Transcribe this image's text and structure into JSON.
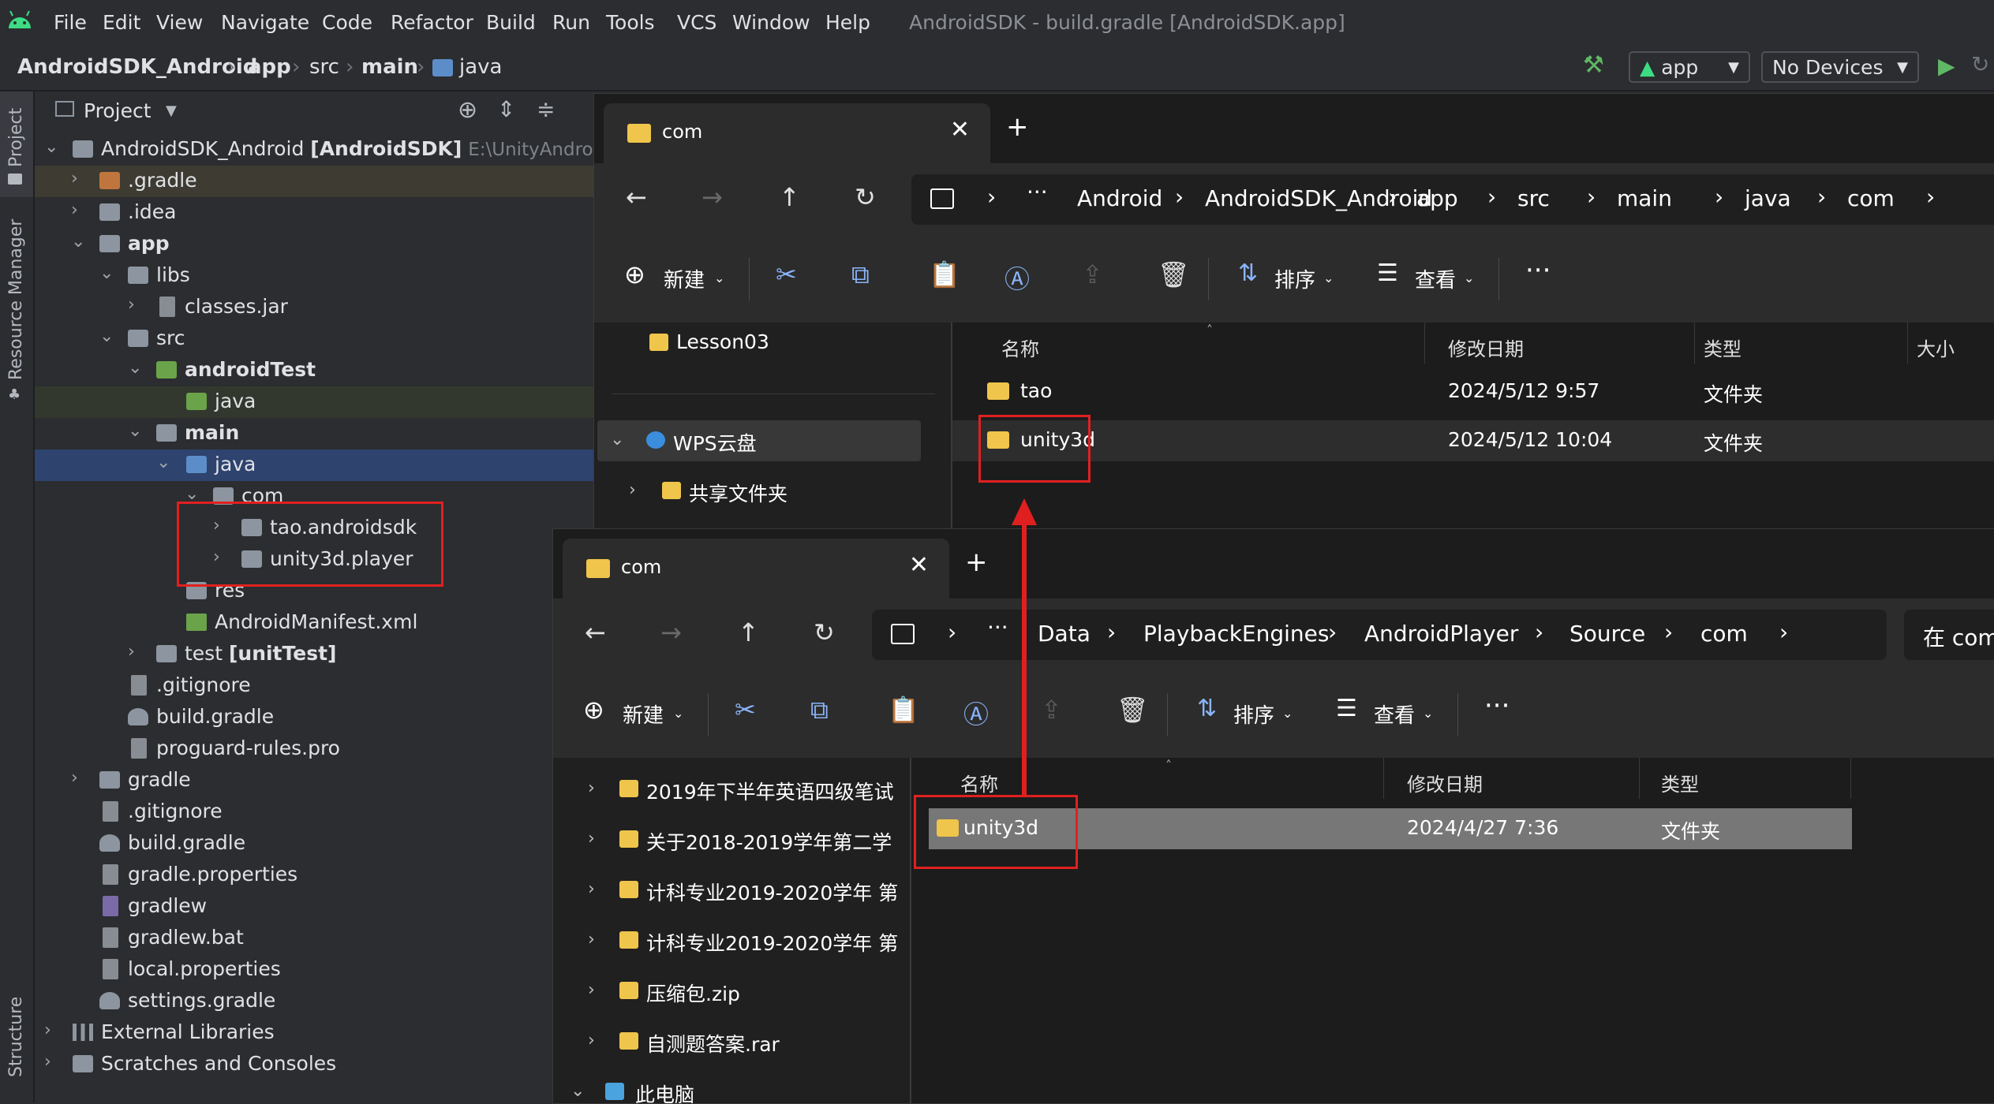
{
  "ide": {
    "menu": [
      "File",
      "Edit",
      "View",
      "Navigate",
      "Code",
      "Refactor",
      "Build",
      "Run",
      "Tools",
      "VCS",
      "Window",
      "Help"
    ],
    "window_title": "AndroidSDK - build.gradle [AndroidSDK.app]",
    "breadcrumbs": [
      "AndroidSDK_Android",
      "app",
      "src",
      "main",
      "java"
    ],
    "run_config": "app",
    "device": "No Devices",
    "side_tabs": [
      "Project",
      "Resource Manager",
      "Structure"
    ],
    "panel_title": "Project",
    "tree": [
      {
        "label": "AndroidSDK_Android",
        "bold_suffix": "[AndroidSDK]",
        "path": "E:\\UnityAndroid\\"
      },
      {
        "label": ".gradle"
      },
      {
        "label": ".idea"
      },
      {
        "label": "app"
      },
      {
        "label": "libs"
      },
      {
        "label": "classes.jar"
      },
      {
        "label": "src"
      },
      {
        "label": "androidTest"
      },
      {
        "label": "java"
      },
      {
        "label": "main"
      },
      {
        "label": "java"
      },
      {
        "label": "com"
      },
      {
        "label": "tao.androidsdk"
      },
      {
        "label": "unity3d.player"
      },
      {
        "label": "res"
      },
      {
        "label": "AndroidManifest.xml"
      },
      {
        "label": "test",
        "bold_suffix": "[unitTest]"
      },
      {
        "label": ".gitignore"
      },
      {
        "label": "build.gradle"
      },
      {
        "label": "proguard-rules.pro"
      },
      {
        "label": "gradle"
      },
      {
        "label": ".gitignore"
      },
      {
        "label": "build.gradle"
      },
      {
        "label": "gradle.properties"
      },
      {
        "label": "gradlew"
      },
      {
        "label": "gradlew.bat"
      },
      {
        "label": "local.properties"
      },
      {
        "label": "settings.gradle"
      },
      {
        "label": "External Libraries"
      },
      {
        "label": "Scratches and Consoles"
      }
    ]
  },
  "explorer1": {
    "tab_title": "com",
    "path": [
      "Android",
      "AndroidSDK_Android",
      "app",
      "src",
      "main",
      "java",
      "com"
    ],
    "toolbar": {
      "new": "新建",
      "sort": "排序",
      "view": "查看"
    },
    "nav": [
      "Lesson03",
      "WPS云盘",
      "共享文件夹"
    ],
    "columns": [
      "名称",
      "修改日期",
      "类型",
      "大小"
    ],
    "files": [
      {
        "name": "tao",
        "date": "2024/5/12 9:57",
        "type": "文件夹"
      },
      {
        "name": "unity3d",
        "date": "2024/5/12 10:04",
        "type": "文件夹"
      }
    ]
  },
  "explorer2": {
    "tab_title": "com",
    "path": [
      "Data",
      "PlaybackEngines",
      "AndroidPlayer",
      "Source",
      "com"
    ],
    "search_placeholder": "在 com",
    "toolbar": {
      "new": "新建",
      "sort": "排序",
      "view": "查看"
    },
    "nav": [
      "2019年下半年英语四级笔试",
      "关于2018-2019学年第二学",
      "计科专业2019-2020学年 第",
      "计科专业2019-2020学年 第",
      "压缩包.zip",
      "自测题答案.rar",
      "此电脑"
    ],
    "columns": [
      "名称",
      "修改日期",
      "类型"
    ],
    "files": [
      {
        "name": "unity3d",
        "date": "2024/4/27 7:36",
        "type": "文件夹"
      }
    ]
  },
  "colors": {
    "accent_red": "#e02020",
    "folder_yellow": "#f0c54b",
    "ide_bg": "#2b2d30",
    "explorer_bg": "#202020"
  }
}
